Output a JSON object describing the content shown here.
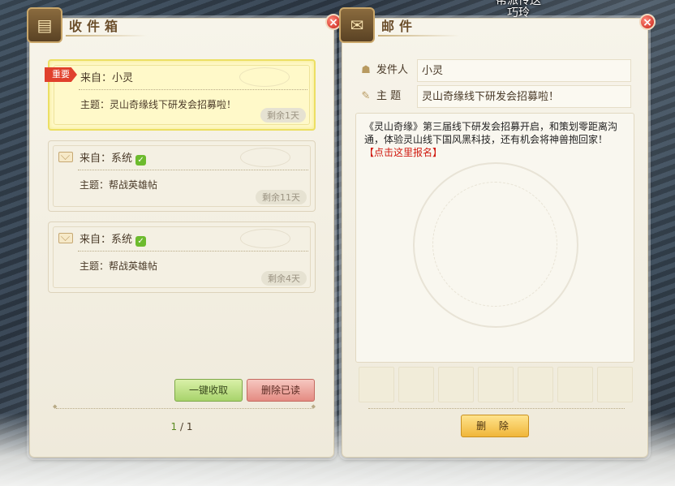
{
  "top_banner": {
    "line1": "帮派传送",
    "line2": "巧玲"
  },
  "inbox": {
    "title": "收件箱",
    "items": [
      {
        "badge": "重要",
        "from_label": "来自：",
        "sender": "小灵",
        "verified": false,
        "subject": "主题：灵山奇缘线下研发会招募啦！",
        "remaining": "剩余1天",
        "selected": true
      },
      {
        "badge": "",
        "from_label": "来自：",
        "sender": "系统",
        "verified": true,
        "subject": "主题：帮战英雄帖",
        "remaining": "剩余11天",
        "selected": false
      },
      {
        "badge": "",
        "from_label": "来自：",
        "sender": "系统",
        "verified": true,
        "subject": "主题：帮战英雄帖",
        "remaining": "剩余4天",
        "selected": false
      }
    ],
    "collect_all_label": "一键收取",
    "delete_read_label": "删除已读",
    "page_current": "1",
    "page_sep": " / ",
    "page_total": "1"
  },
  "mail": {
    "title": "邮件",
    "sender_label": "发件人",
    "sender_value": "小灵",
    "subject_label": "主 题",
    "subject_value": "灵山奇缘线下研发会招募啦！",
    "body": "《灵山奇缘》第三届线下研发会招募开启，和策划零距离沟通，体验灵山线下国风黑科技，还有机会将神兽抱回家！",
    "body_link": "【点击这里报名】",
    "attachment_slots": 7,
    "delete_label": "删 除"
  },
  "icons": {
    "close": "close-icon",
    "envelope": "envelope-icon",
    "verified": "verified-check-icon"
  },
  "colors": {
    "important_badge": "#e0402c",
    "link": "#d01a10",
    "verified": "#6dbb2e"
  }
}
